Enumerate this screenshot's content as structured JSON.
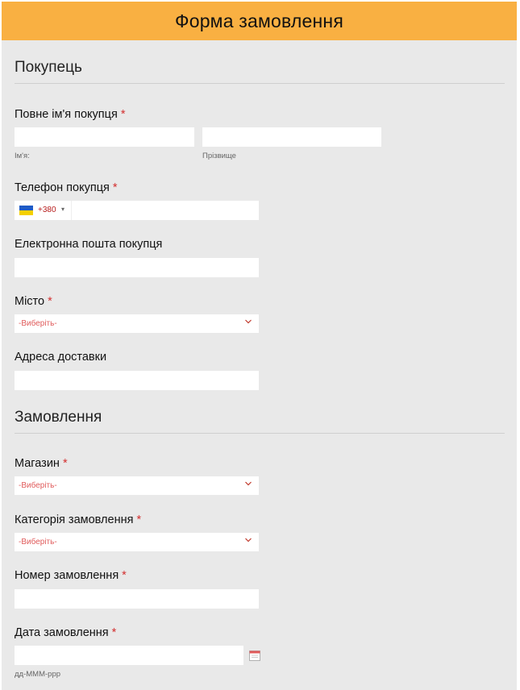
{
  "header": {
    "title": "Форма замовлення"
  },
  "sections": {
    "buyer": "Покупець",
    "order": "Замовлення"
  },
  "fields": {
    "full_name": {
      "label": "Повне ім'я покупця",
      "required": "*",
      "first_sub": "Ім'я:",
      "last_sub": "Прізвище"
    },
    "phone": {
      "label": "Телефон покупця",
      "required": "*",
      "country_code": "+380",
      "caret": "▾"
    },
    "email": {
      "label": "Електронна пошта покупця"
    },
    "city": {
      "label": "Місто",
      "required": "*",
      "selected": "-Виберіть-"
    },
    "address": {
      "label": "Адреса доставки"
    },
    "shop": {
      "label": "Магазин",
      "required": "*",
      "selected": "-Виберіть-"
    },
    "category": {
      "label": "Категорія замовлення",
      "required": "*",
      "selected": "-Виберіть-"
    },
    "order_number": {
      "label": "Номер замовлення",
      "required": "*"
    },
    "order_date": {
      "label": "Дата замовлення",
      "required": "*",
      "format_hint": "дд-МММ-ррр"
    }
  },
  "colors": {
    "header_bg": "#f9b042",
    "required": "#d32f2f",
    "select_placeholder": "#e05a5a"
  },
  "icons": {
    "phone_flag": "ukraine-flag-icon",
    "select_arrow": "chevron-down-icon",
    "date_picker": "calendar-icon"
  }
}
